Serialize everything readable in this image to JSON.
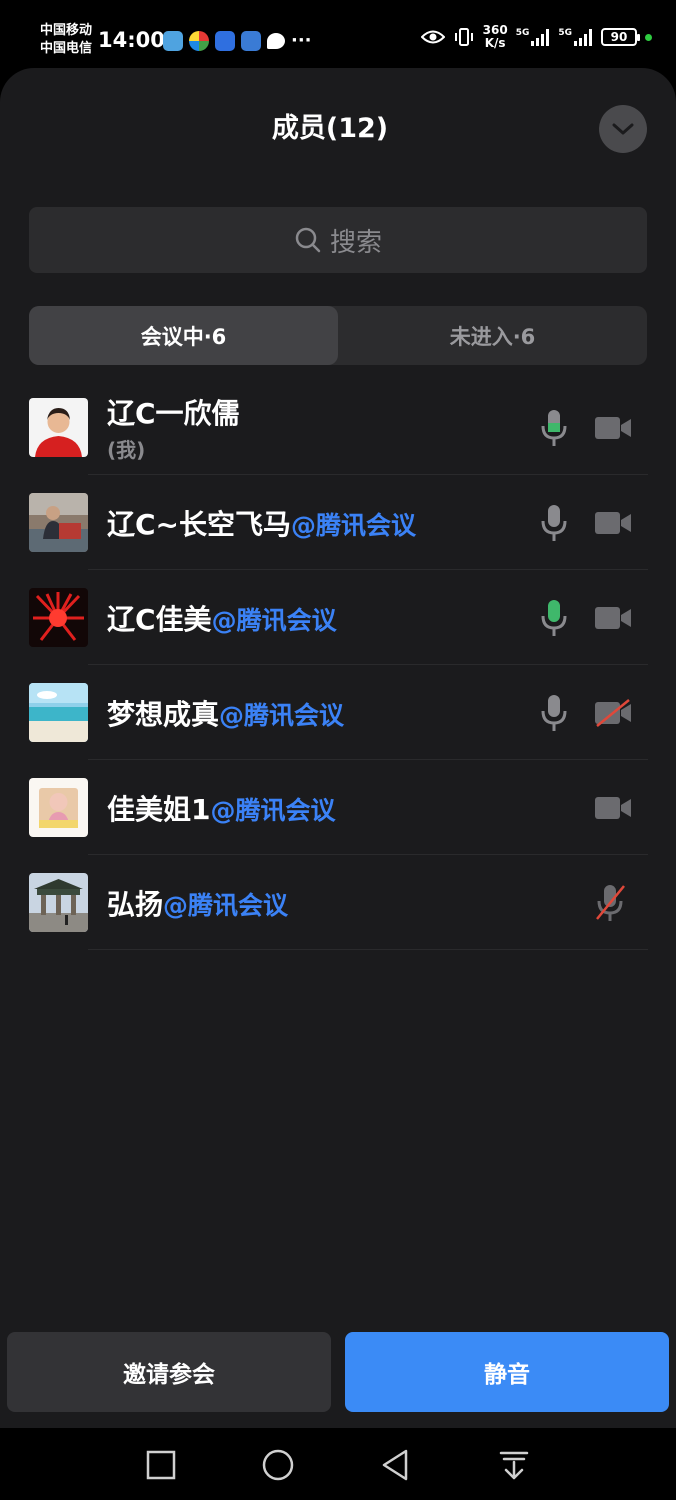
{
  "status_bar": {
    "carrier1": "中国移动",
    "carrier2": "中国电信",
    "time": "14:00",
    "more": "···",
    "net_speed_value": "360",
    "net_speed_unit": "K/s",
    "signal1_label": "5G",
    "signal2_label": "5G",
    "battery": "90"
  },
  "header": {
    "title": "成员(12)"
  },
  "search": {
    "placeholder": "搜索"
  },
  "tabs": [
    {
      "label": "会议中·6",
      "active": true
    },
    {
      "label": "未进入·6",
      "active": false
    }
  ],
  "members": [
    {
      "name": "辽C一欣儒",
      "suffix": "",
      "sub": "(我)",
      "mic": "active",
      "camera": "off"
    },
    {
      "name": "辽C~长空飞马",
      "suffix": "@腾讯会议",
      "sub": "",
      "mic": "on",
      "camera": "off"
    },
    {
      "name": "辽C佳美",
      "suffix": "@腾讯会议",
      "sub": "",
      "mic": "active",
      "camera": "off"
    },
    {
      "name": "梦想成真",
      "suffix": "@腾讯会议",
      "sub": "",
      "mic": "on",
      "camera": "disabled"
    },
    {
      "name": "佳美姐1",
      "suffix": "@腾讯会议",
      "sub": "",
      "mic": "none",
      "camera": "off"
    },
    {
      "name": "弘扬",
      "suffix": "@腾讯会议",
      "sub": "",
      "mic": "muted",
      "camera": "none"
    }
  ],
  "actions": {
    "invite": "邀请参会",
    "mute": "静音"
  },
  "colors": {
    "panel_bg": "#1b1b1d",
    "accent_blue": "#3b8bf6",
    "suffix_blue": "#3b82f6",
    "mic_active_green": "#3fb86b",
    "muted_red": "#e0483a"
  },
  "icons": [
    "search-icon",
    "chevron-down-icon",
    "microphone-icon",
    "video-camera-icon",
    "microphone-muted-icon",
    "video-camera-off-icon",
    "square-nav-icon",
    "circle-nav-icon",
    "back-triangle-icon",
    "notification-down-icon"
  ]
}
